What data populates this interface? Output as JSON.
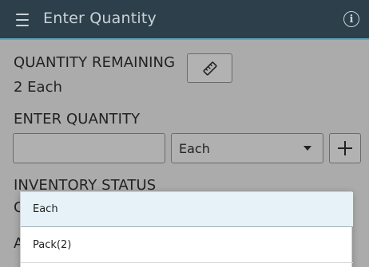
{
  "header": {
    "title": "Enter Quantity",
    "menu_icon": "hamburger-menu-icon",
    "info_icon": "info-icon",
    "info_glyph": "i"
  },
  "quantity_remaining": {
    "label": "QUANTITY REMAINING",
    "value": "2 Each",
    "measure_icon": "ruler-icon"
  },
  "enter_quantity": {
    "label": "ENTER QUANTITY",
    "input_value": "",
    "uom_selected": "Each",
    "add_icon": "plus-icon"
  },
  "inventory_status": {
    "label": "INVENTORY STATUS",
    "partial_value": "C"
  },
  "next_section": {
    "partial_label": "A"
  },
  "uom_dropdown": {
    "options": [
      "Each",
      "Pack(2)"
    ],
    "selected_index": 0
  },
  "colors": {
    "header_bg": "#2d3f4a",
    "accent": "#55a4ba",
    "overlay_bg": "#ababab",
    "selected_option_bg": "#e6f2f7"
  }
}
